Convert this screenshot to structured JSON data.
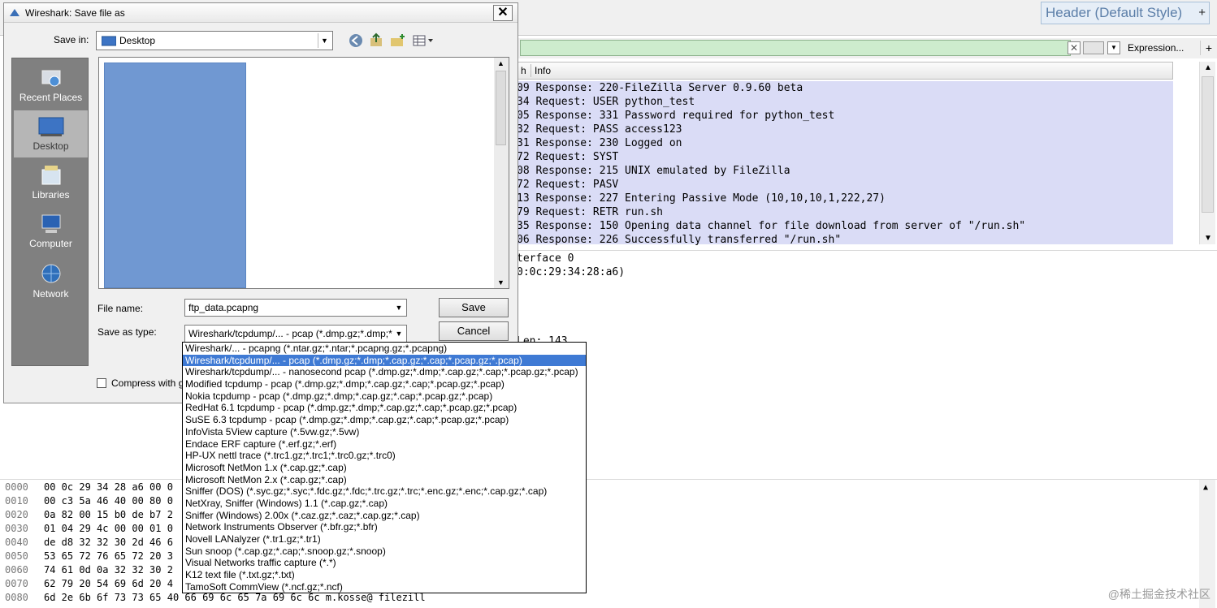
{
  "bg": {
    "header_style_label": "Header (Default Style)",
    "header_style_plus": "+",
    "filter_clear": "✕",
    "expression_label": "Expression...",
    "add_button_label": "+",
    "col_len_partial": "h",
    "col_info": "Info",
    "packets": [
      "09 Response: 220-FileZilla Server 0.9.60 beta",
      "34 Request: USER python_test",
      "05 Response: 331 Password required for python_test",
      "32 Request: PASS access123",
      "31 Response: 230 Logged on",
      "72 Request: SYST",
      "08 Response: 215 UNIX emulated by FileZilla",
      "72 Request: PASV",
      "13 Response: 227 Entering Passive Mode (10,10,10,1,222,27)",
      "79 Request: RETR run.sh",
      "35 Response: 150 Opening data channel for file download from server of \"/run.sh\"",
      "06 Response: 226 Successfully transferred \"/run.sh\""
    ],
    "details": [
      "terface 0",
      "0:0c:29:34:28:a6)",
      "Len: 143"
    ],
    "bytes": [
      {
        "off": "0000",
        "hex": "00 0c 29 34 28 a6 00 0"
      },
      {
        "off": "0010",
        "hex": "00 c3 5a 46 40 00 80 0"
      },
      {
        "off": "0020",
        "hex": "0a 82 00 15 b0 de b7 2"
      },
      {
        "off": "0030",
        "hex": "01 04 29 4c 00 00 01 0"
      },
      {
        "off": "0040",
        "hex": "de d8 32 32 30 2d 46 6"
      },
      {
        "off": "0050",
        "hex": "53 65 72 76 65 72 20 3"
      },
      {
        "off": "0060",
        "hex": "74 61 0d 0a 32 32 30 2"
      },
      {
        "off": "0070",
        "hex": "62 79 20 54 69 6d 20 4"
      },
      {
        "off": "0080",
        "hex": "6d 2e 6b 6f 73 73 65 40  66 69 6c 65 7a 69 6c 6c   m.kosse@ filezill"
      }
    ],
    "watermark": "@稀土掘金技术社区"
  },
  "dialog": {
    "title": "Wireshark: Save file as",
    "close": "✕",
    "save_in_label": "Save in:",
    "save_in_value": "Desktop",
    "places": [
      "Recent Places",
      "Desktop",
      "Libraries",
      "Computer",
      "Network"
    ],
    "file_name_label": "File name:",
    "file_name_value": "ftp_data.pcapng",
    "save_as_type_label": "Save as type:",
    "save_as_type_value": "Wireshark/tcpdump/... - pcap (*.dmp.gz;*.dmp;*",
    "save_button": "Save",
    "cancel_button": "Cancel",
    "compress_label": "Compress with g"
  },
  "file_types": [
    "Wireshark/... - pcapng (*.ntar.gz;*.ntar;*.pcapng.gz;*.pcapng)",
    "Wireshark/tcpdump/... - pcap (*.dmp.gz;*.dmp;*.cap.gz;*.cap;*.pcap.gz;*.pcap)",
    "Wireshark/tcpdump/... - nanosecond pcap (*.dmp.gz;*.dmp;*.cap.gz;*.cap;*.pcap.gz;*.pcap)",
    "Modified tcpdump - pcap (*.dmp.gz;*.dmp;*.cap.gz;*.cap;*.pcap.gz;*.pcap)",
    "Nokia tcpdump - pcap (*.dmp.gz;*.dmp;*.cap.gz;*.cap;*.pcap.gz;*.pcap)",
    "RedHat 6.1 tcpdump - pcap (*.dmp.gz;*.dmp;*.cap.gz;*.cap;*.pcap.gz;*.pcap)",
    "SuSE 6.3 tcpdump - pcap (*.dmp.gz;*.dmp;*.cap.gz;*.cap;*.pcap.gz;*.pcap)",
    "InfoVista 5View capture (*.5vw.gz;*.5vw)",
    "Endace ERF capture (*.erf.gz;*.erf)",
    "HP-UX nettl trace (*.trc1.gz;*.trc1;*.trc0.gz;*.trc0)",
    "Microsoft NetMon 1.x (*.cap.gz;*.cap)",
    "Microsoft NetMon 2.x (*.cap.gz;*.cap)",
    "Sniffer (DOS) (*.syc.gz;*.syc;*.fdc.gz;*.fdc;*.trc.gz;*.trc;*.enc.gz;*.enc;*.cap.gz;*.cap)",
    "NetXray, Sniffer (Windows) 1.1 (*.cap.gz;*.cap)",
    "Sniffer (Windows) 2.00x (*.caz.gz;*.caz;*.cap.gz;*.cap)",
    "Network Instruments Observer (*.bfr.gz;*.bfr)",
    "Novell LANalyzer (*.tr1.gz;*.tr1)",
    "Sun snoop (*.cap.gz;*.cap;*.snoop.gz;*.snoop)",
    "Visual Networks traffic capture (*.*)",
    "K12 text file (*.txt.gz;*.txt)",
    "TamoSoft CommView (*.ncf.gz;*.ncf)"
  ],
  "selected_type_index": 1,
  "colors": {
    "selection": "#3f7ad4",
    "packet_bg": "#dadcf6",
    "filter_bg": "#cdeccd"
  }
}
